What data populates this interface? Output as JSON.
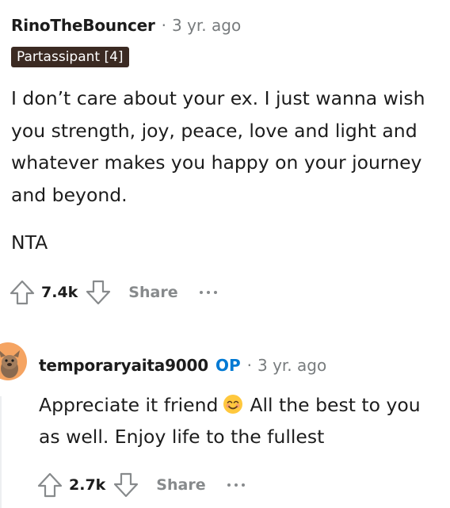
{
  "comment1": {
    "author": "RinoTheBouncer",
    "separator": "·",
    "time": "3 yr. ago",
    "flair": "Partassipant [4]",
    "body_paragraph_1": "I don’t care about your ex. I just wanna wish you strength, joy, peace, love and light and whatever makes you happy on your journey and beyond.",
    "body_paragraph_2": "NTA",
    "score": "7.4k",
    "share_label": "Share"
  },
  "comment2": {
    "author": "temporaryaita9000",
    "op_badge": "OP",
    "separator": "·",
    "time": "3 yr. ago",
    "body_before_emoji": "Appreciate it friend",
    "emoji": "😊",
    "body_after_emoji": "All the best to you as well. Enjoy life to the fullest",
    "score": "2.7k",
    "share_label": "Share"
  },
  "icons": [
    "upvote-icon",
    "downvote-icon",
    "more-options-icon",
    "smiling-face-emoji",
    "avatar"
  ],
  "colors": {
    "text": "#1c1c1c",
    "meta": "#787c7e",
    "action": "#878a8c",
    "flair_bg": "#3b2a22",
    "op": "#0079d3",
    "avatar": "#f5a462"
  }
}
